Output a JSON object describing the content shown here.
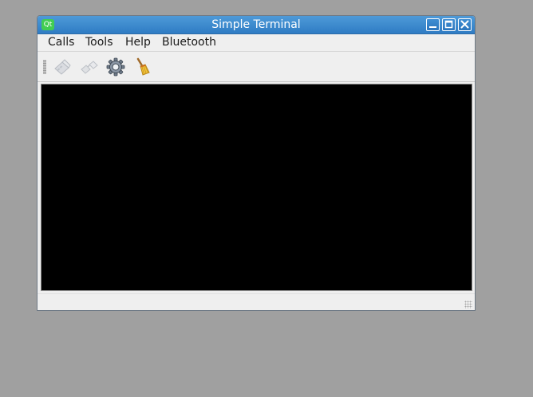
{
  "window": {
    "title": "Simple Terminal",
    "logo_text": "Qt"
  },
  "menu": {
    "items": [
      {
        "label": "Calls"
      },
      {
        "label": "Tools"
      },
      {
        "label": "Help"
      },
      {
        "label": "Bluetooth"
      }
    ]
  },
  "toolbar": {
    "buttons": [
      {
        "icon": "connect-icon",
        "enabled": false
      },
      {
        "icon": "disconnect-icon",
        "enabled": false
      },
      {
        "icon": "settings-gear-icon",
        "enabled": true
      },
      {
        "icon": "clear-broom-icon",
        "enabled": true
      }
    ]
  },
  "colors": {
    "titlebar": "#2f7cc4",
    "terminal_background": "#000000",
    "desktop": "#a0a0a0"
  }
}
